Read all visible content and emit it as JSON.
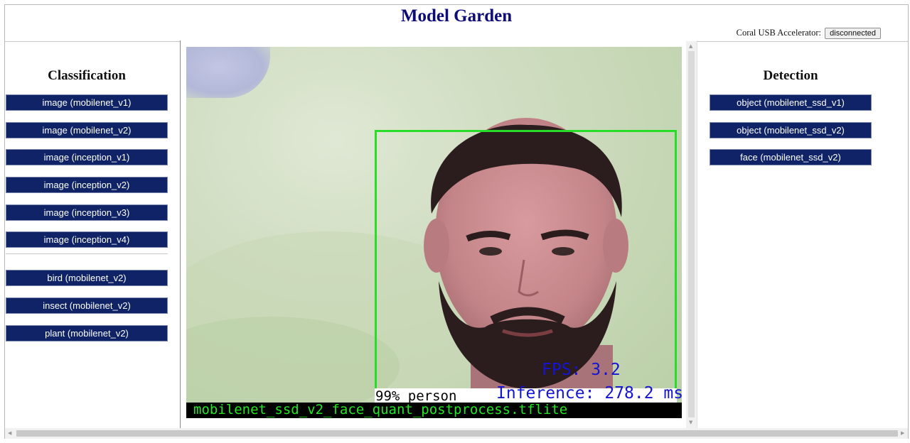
{
  "header": {
    "title": "Model Garden",
    "coral_label": "Coral USB Accelerator:",
    "coral_status_button": "disconnected"
  },
  "classification": {
    "title": "Classification",
    "models": [
      "image (mobilenet_v1)",
      "image (mobilenet_v2)",
      "image (inception_v1)",
      "image (inception_v2)",
      "image (inception_v3)",
      "image (inception_v4)"
    ],
    "specialized_models": [
      "bird (mobilenet_v2)",
      "insect (mobilenet_v2)",
      "plant (mobilenet_v2)"
    ]
  },
  "detection": {
    "title": "Detection",
    "models": [
      "object (mobilenet_ssd_v1)",
      "object (mobilenet_ssd_v2)",
      "face (mobilenet_ssd_v2)"
    ]
  },
  "video_overlay": {
    "detection_label": "99% person",
    "fps": "FPS: 3.2",
    "inference": "Inference: 278.2 ms",
    "model_file": "mobilenet_ssd_v2_face_quant_postprocess.tflite",
    "box_color": "#28dd28",
    "stats_color": "#1414d2",
    "model_file_color": "#22e622"
  },
  "colors": {
    "title": "#0d0d78",
    "button_bg": "#0f2366",
    "button_text": "#ffffff"
  }
}
